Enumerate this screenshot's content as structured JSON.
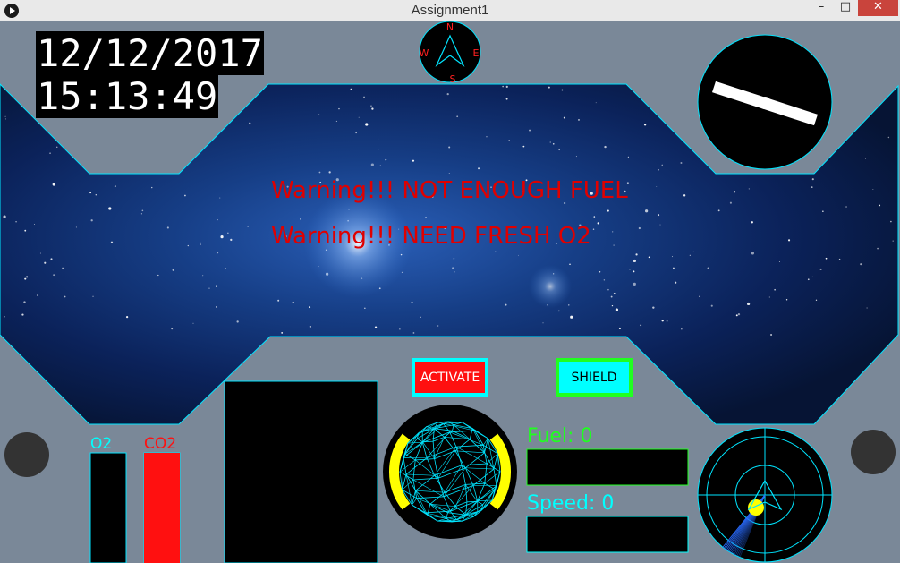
{
  "window": {
    "title": "Assignment1"
  },
  "controls": {
    "minimize": "–",
    "maximize": "□",
    "close": "✕"
  },
  "clock": {
    "date": "12/12/2017",
    "time": "15:13:49"
  },
  "compass": {
    "north": "N",
    "east": "E",
    "south": "S",
    "west": "W"
  },
  "warnings": {
    "fuel": "Warning!!! NOT ENOUGH FUEL",
    "o2": "Warning!!! NEED FRESH O2"
  },
  "buttons": {
    "activate": "ACTIVATE",
    "shield": "SHIELD"
  },
  "gauges": {
    "fuel": {
      "label": "Fuel: 0",
      "level": 0
    },
    "speed": {
      "label": "Speed: 0",
      "level": 0
    }
  },
  "gases": {
    "o2": {
      "label": "O2",
      "level": 0
    },
    "co2": {
      "label": "CO2",
      "level": 1
    }
  },
  "colors": {
    "panel": "#7a8898",
    "outline": "#00e5ff",
    "warning": "#e00000",
    "fuel": "#20ff20",
    "speed": "#00ffff",
    "shield_ring": "#ffff00",
    "co2": "#ff1010"
  }
}
